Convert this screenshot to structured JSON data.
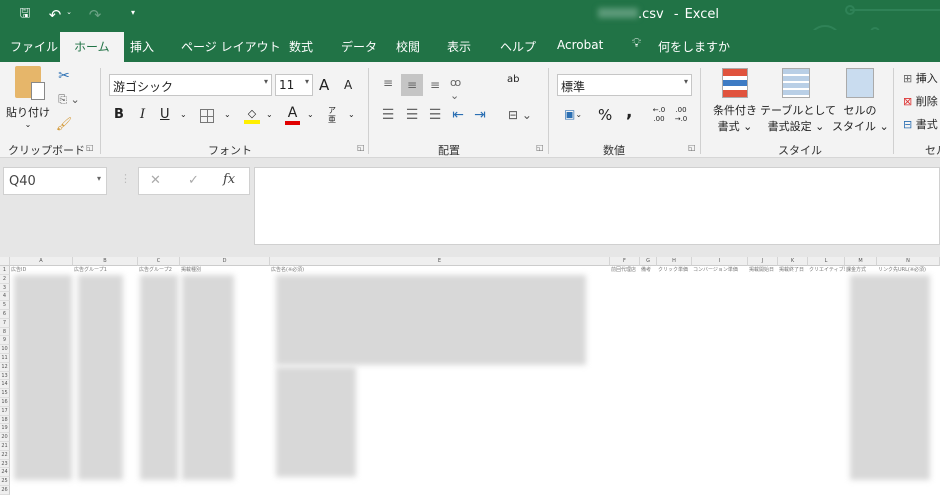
{
  "title_bar": {
    "filename_suffix": ".csv",
    "separator": "-",
    "app": "Excel"
  },
  "quick_access": {
    "save": "save-icon",
    "undo": "undo-icon",
    "redo": "redo-icon",
    "customize": "chevron-down-icon"
  },
  "tabs": [
    "ファイル",
    "ホーム",
    "挿入",
    "ページ レイアウト",
    "数式",
    "データ",
    "校閲",
    "表示",
    "ヘルプ",
    "Acrobat"
  ],
  "active_tab": "ホーム",
  "tell_me": "何をしますか",
  "ribbon": {
    "clipboard": {
      "label": "クリップボード",
      "paste": "貼り付け"
    },
    "font": {
      "label": "フォント",
      "font_name": "游ゴシック",
      "font_size": "11",
      "bold": "B",
      "italic": "I",
      "underline": "U",
      "grow": "A",
      "shrink": "A",
      "font_color": "A",
      "phonetic": "ア亜"
    },
    "alignment": {
      "label": "配置",
      "wrap": "ab"
    },
    "number": {
      "label": "数値",
      "format": "標準",
      "percent": "%",
      "comma": ",",
      "inc_decimal": "←.0 .00",
      "dec_decimal": ".00 →.0"
    },
    "styles": {
      "label": "スタイル",
      "conditional": [
        "条件付き",
        "書式"
      ],
      "table": [
        "テーブルとして",
        "書式設定"
      ],
      "cell_styles": [
        "セルの",
        "スタイル"
      ]
    },
    "cells": {
      "label": "セル",
      "insert": "挿入",
      "delete": "削除",
      "format": "書式"
    }
  },
  "formula_bar": {
    "name_box": "Q40",
    "cancel": "✕",
    "enter": "✓",
    "fx": "fx",
    "value": ""
  },
  "sheet": {
    "columns": [
      "A",
      "B",
      "C",
      "D",
      "E",
      "F",
      "G",
      "H",
      "I",
      "J",
      "K",
      "L",
      "M",
      "N"
    ],
    "headers": [
      "広告ID",
      "広告グループ1",
      "広告グループ2",
      "掲載種別",
      "広告名(※必須)",
      "前回代理店",
      "備考",
      "クリック単価",
      "コンバージョン単価",
      "掲載開始日",
      "掲載終了日",
      "クリエイティブ単価",
      "課金方式",
      "リンク先URL(※必須)"
    ],
    "row_labels": [
      "1",
      "2",
      "3",
      "4",
      "5",
      "6",
      "7",
      "8",
      "9",
      "10",
      "11",
      "12",
      "13",
      "14",
      "15",
      "16",
      "17",
      "18",
      "19",
      "20",
      "21",
      "22",
      "23",
      "24",
      "25",
      "26"
    ]
  },
  "colors": {
    "brand": "#217346",
    "ribbon_bg": "#f3f3f3"
  }
}
